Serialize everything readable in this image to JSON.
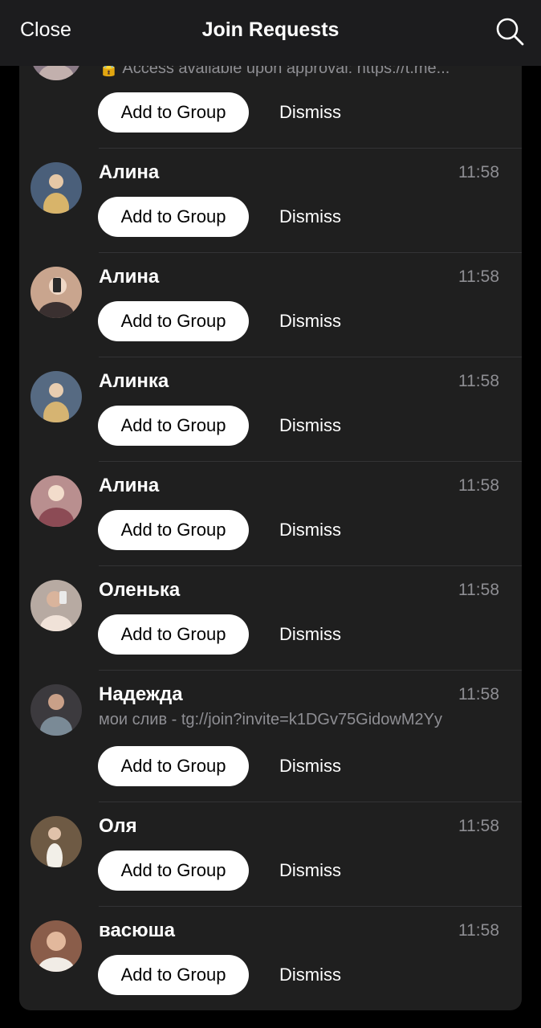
{
  "header": {
    "close_label": "Close",
    "title": "Join Requests",
    "search_icon": "search-icon"
  },
  "requests": [
    {
      "name": "",
      "time": "",
      "message": "🔒 Access available upon approval: https://t.me...",
      "add_label": "Add to Group",
      "dismiss_label": "Dismiss",
      "avatar_color": "#8a7a86"
    },
    {
      "name": "Алина",
      "time": "11:58",
      "add_label": "Add to Group",
      "dismiss_label": "Dismiss",
      "avatar_color": "#4a5f7a"
    },
    {
      "name": "Алина",
      "time": "11:58",
      "add_label": "Add to Group",
      "dismiss_label": "Dismiss",
      "avatar_color": "#c9a58e"
    },
    {
      "name": "Алинка",
      "time": "11:58",
      "add_label": "Add to Group",
      "dismiss_label": "Dismiss",
      "avatar_color": "#566a82"
    },
    {
      "name": "Алина",
      "time": "11:58",
      "add_label": "Add to Group",
      "dismiss_label": "Dismiss",
      "avatar_color": "#b98f8f"
    },
    {
      "name": "Оленька",
      "time": "11:58",
      "add_label": "Add to Group",
      "dismiss_label": "Dismiss",
      "avatar_color": "#b7aaa2"
    },
    {
      "name": "Надежда",
      "time": "11:58",
      "message": "мои слив - tg://join?invite=k1DGv75GidowM2Yy",
      "add_label": "Add to Group",
      "dismiss_label": "Dismiss",
      "avatar_color": "#3c3a3e"
    },
    {
      "name": "Оля",
      "time": "11:58",
      "add_label": "Add to Group",
      "dismiss_label": "Dismiss",
      "avatar_color": "#6e5a44"
    },
    {
      "name": "васюша",
      "time": "11:58",
      "add_label": "Add to Group",
      "dismiss_label": "Dismiss",
      "avatar_color": "#8a5d4a"
    }
  ]
}
